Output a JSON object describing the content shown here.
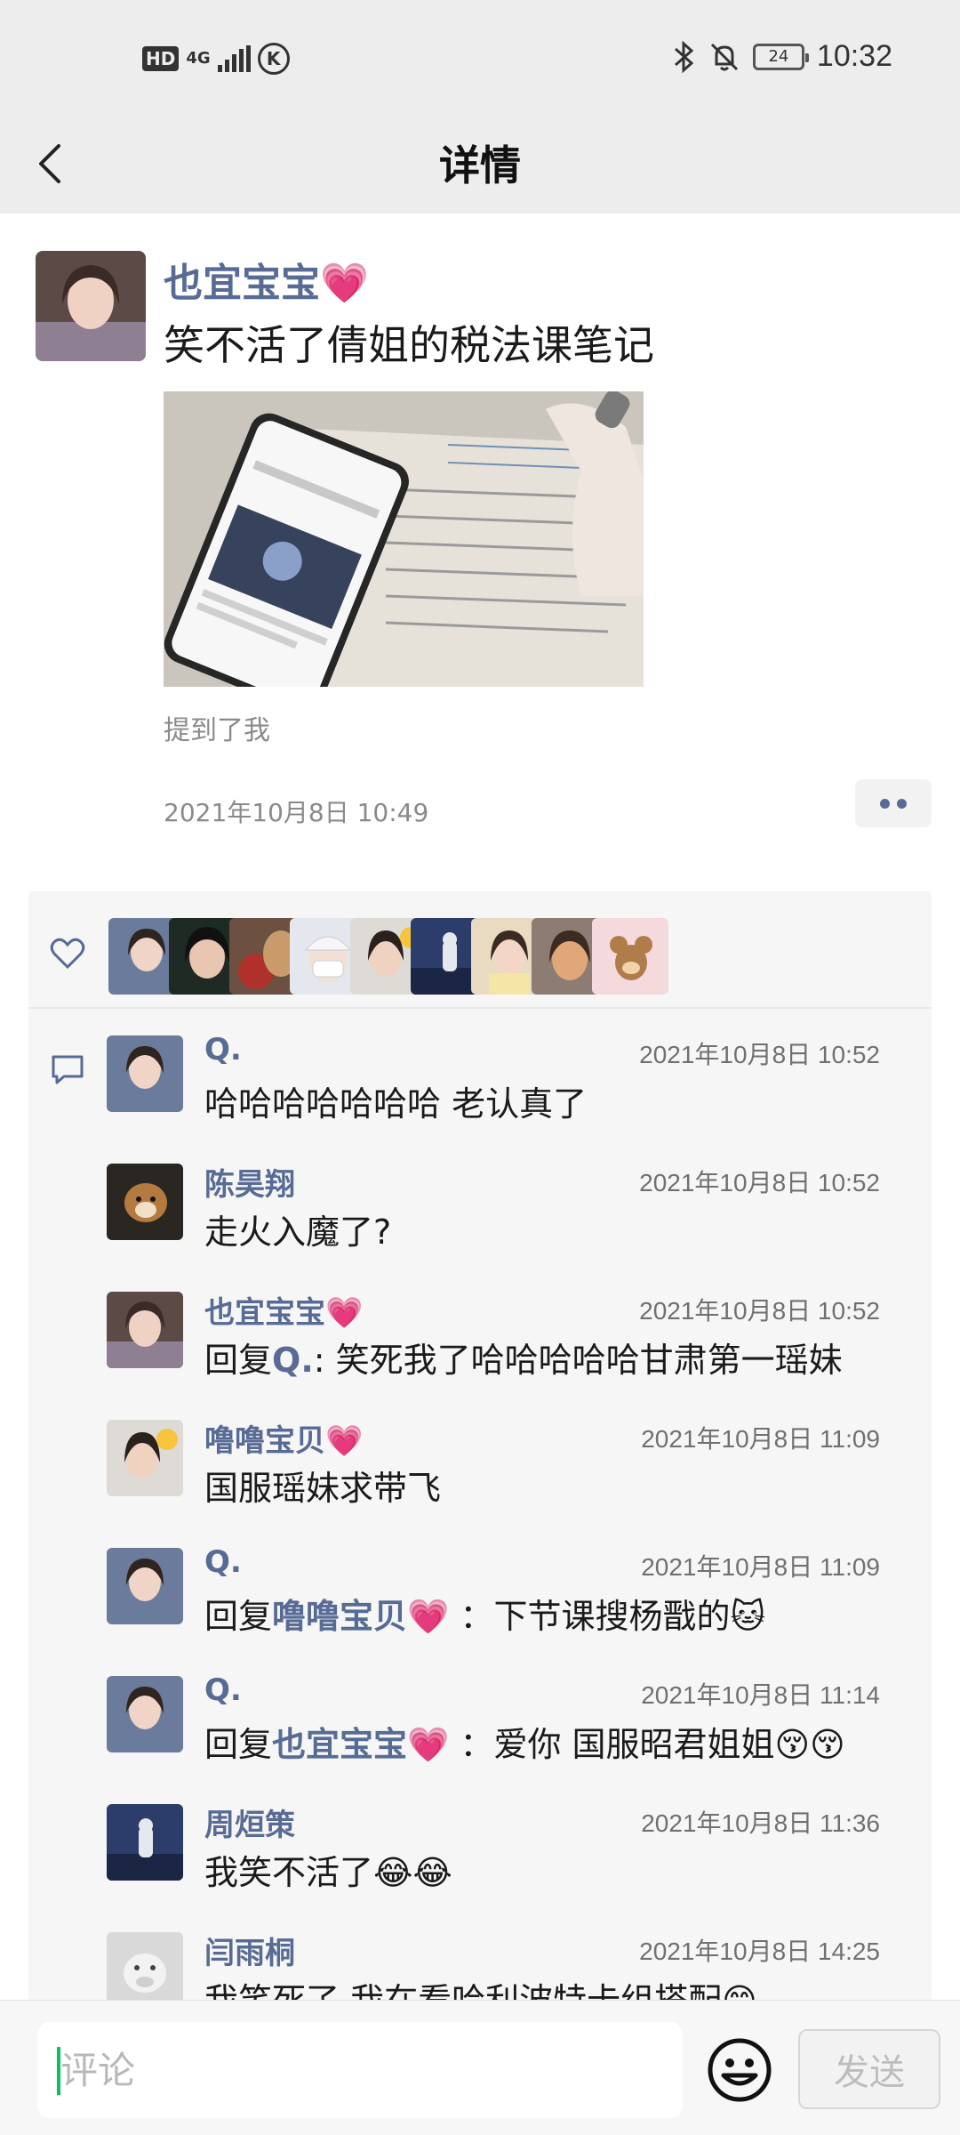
{
  "status_bar": {
    "hd_label": "HD",
    "network_label": "4G",
    "k_label": "K",
    "battery_level": "24",
    "time": "10:32"
  },
  "nav": {
    "title": "详情"
  },
  "post": {
    "author": "也宜宝宝💗",
    "text": "笑不活了倩姐的税法课笔记",
    "mention": "提到了我",
    "time": "2021年10月8日  10:49"
  },
  "likes": {
    "count_shown": 9
  },
  "comments": [
    {
      "name": "Q.",
      "time": "2021年10月8日  10:52",
      "text": "哈哈哈哈哈哈哈  老认真了",
      "reply_prefix": "",
      "reply_to": "",
      "reply_sep": ""
    },
    {
      "name": "陈昊翔",
      "time": "2021年10月8日  10:52",
      "text": "走火入魔了?",
      "reply_prefix": "",
      "reply_to": "",
      "reply_sep": ""
    },
    {
      "name": "也宜宝宝💗",
      "time": "2021年10月8日  10:52",
      "text": "笑死我了哈哈哈哈哈甘肃第一瑶妹",
      "reply_prefix": "回复",
      "reply_to": "Q.",
      "reply_sep": ": "
    },
    {
      "name": "噜噜宝贝💗",
      "time": "2021年10月8日  11:09",
      "text": "国服瑶妹求带飞",
      "reply_prefix": "",
      "reply_to": "",
      "reply_sep": ""
    },
    {
      "name": "Q.",
      "time": "2021年10月8日  11:09",
      "text": "下节课搜杨戬的🐱",
      "reply_prefix": "回复",
      "reply_to": "噜噜宝贝💗",
      "reply_sep": " ："
    },
    {
      "name": "Q.",
      "time": "2021年10月8日  11:14",
      "text": "爱你  国服昭君姐姐😚😚",
      "reply_prefix": "回复",
      "reply_to": "也宜宝宝💗",
      "reply_sep": " ："
    },
    {
      "name": "周烜策",
      "time": "2021年10月8日  11:36",
      "text": "我笑不活了😂😂",
      "reply_prefix": "",
      "reply_to": "",
      "reply_sep": ""
    },
    {
      "name": "闫雨桐",
      "time": "2021年10月8日  14:25",
      "text": "我笑死了  我在看哈利波特卡组搭配😁",
      "reply_prefix": "",
      "reply_to": "",
      "reply_sep": ""
    }
  ],
  "input": {
    "placeholder": "评论",
    "value": "",
    "send_label": "发送"
  },
  "colors": {
    "link": "#576b95",
    "background": "#ededed",
    "panel": "#f6f6f6",
    "caret": "#07c160"
  },
  "icons": [
    "back-icon",
    "heart-icon",
    "comment-icon",
    "emoji-icon",
    "more-icon",
    "bluetooth-icon",
    "mute-icon",
    "signal-icon"
  ]
}
